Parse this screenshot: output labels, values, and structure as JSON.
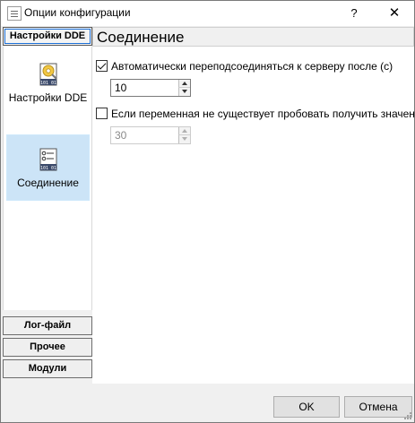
{
  "window": {
    "title": "Опции конфигурации",
    "help_label": "?",
    "close_label": "✕"
  },
  "sidebar": {
    "active_group": "Настройки DDE",
    "items": [
      {
        "label": "Настройки DDE",
        "icon": "settings-dde-icon"
      },
      {
        "label": "Соединение",
        "icon": "connection-icon",
        "selected": true
      }
    ],
    "groups": [
      {
        "label": "Лог-файл"
      },
      {
        "label": "Прочее"
      },
      {
        "label": "Модули"
      }
    ]
  },
  "content": {
    "title": "Соединение",
    "reconnect": {
      "label": "Автоматически переподсоединяться к серверу после (с)",
      "checked": true,
      "value": "10"
    },
    "poll_missing": {
      "label": "Если переменная не существует пробовать получить значение",
      "checked": false,
      "value": "30"
    }
  },
  "footer": {
    "ok_label": "OK",
    "cancel_label": "Отмена"
  }
}
